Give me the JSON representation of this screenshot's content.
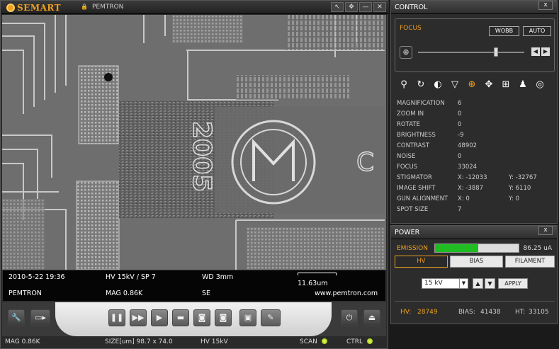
{
  "app": {
    "brand": "SEMART",
    "subtitle": "PEMTRON"
  },
  "window_buttons": [
    "pin-icon",
    "fullscreen-icon",
    "minimize-icon",
    "close-icon"
  ],
  "info": {
    "datetime": "2010-5-22  19:36",
    "hv_sp": "HV 15kV / SP 7",
    "wd": "WD 3mm",
    "scale": "11.63um",
    "company": "PEMTRON",
    "mag": "MAG 0.86K",
    "detector": "SE",
    "website": "www.pemtron.com"
  },
  "toolbar": {
    "left_icons": [
      "wrench-icon",
      "camera-switch-icon"
    ],
    "center_icons": [
      "pause-icon",
      "fast-forward-icon",
      "play-icon",
      "stop-icon",
      "photo-icon",
      "photo-alt-icon",
      "save-icon",
      "comment-icon"
    ],
    "right_icons": [
      "power-icon",
      "eject-icon"
    ]
  },
  "status": {
    "mag": "MAG 0.86K",
    "size": "SIZE[um] 98.7 x 74.0",
    "hv": "HV 15kV",
    "scan": "SCAN",
    "ctrl": "CTRL"
  },
  "control": {
    "title": "CONTROL",
    "close": "x",
    "focus_label": "FOCUS",
    "wobb": "WOBB",
    "auto": "AUTO",
    "focus_level": 0.73,
    "tool_icons": [
      "zoom-icon",
      "rotate-icon",
      "brightness-icon",
      "filter-icon",
      "focus-target-icon",
      "move-icon",
      "grid-icon",
      "stage-icon",
      "target-icon"
    ],
    "params": [
      {
        "label": "MAGNIFICATION",
        "value": "6"
      },
      {
        "label": "ZOOM IN",
        "value": "0"
      },
      {
        "label": "ROTATE",
        "value": "0"
      },
      {
        "label": "BRIGHTNESS",
        "value": "-9"
      },
      {
        "label": "CONTRAST",
        "value": "48902"
      },
      {
        "label": "NOISE",
        "value": "0"
      },
      {
        "label": "FOCUS",
        "value": "33024"
      },
      {
        "label": "STIGMATOR",
        "value": "X:  -12033",
        "value2": "Y:  -32767"
      },
      {
        "label": "IMAGE SHIFT",
        "value": "X:  -3887",
        "value2": "Y: 6110"
      },
      {
        "label": "GUN ALIGNMENT",
        "value": "X: 0",
        "value2": "Y: 0"
      },
      {
        "label": "SPOT SIZE",
        "value": "7"
      }
    ]
  },
  "power": {
    "title": "POWER",
    "close": "x",
    "emission_label": "EMISSION",
    "emission_value": "86.25 uA",
    "emission_fraction": 0.52,
    "tabs": [
      "HV",
      "BIAS",
      "FILAMENT"
    ],
    "voltage": "15 kV",
    "apply": "APPLY",
    "hv_label": "HV:",
    "hv_value": "28749",
    "bias_label": "BIAS:",
    "bias_value": "41438",
    "ht_label": "HT:",
    "ht_value": "33105"
  }
}
